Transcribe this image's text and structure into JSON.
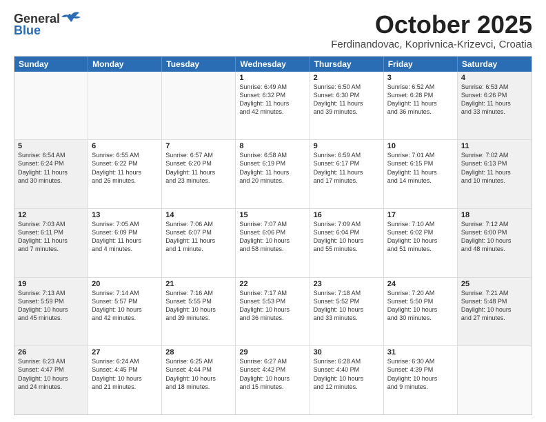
{
  "header": {
    "logo_general": "General",
    "logo_blue": "Blue",
    "month": "October 2025",
    "location": "Ferdinandovac, Koprivnica-Krizevci, Croatia"
  },
  "days_of_week": [
    "Sunday",
    "Monday",
    "Tuesday",
    "Wednesday",
    "Thursday",
    "Friday",
    "Saturday"
  ],
  "weeks": [
    [
      {
        "day": "",
        "text": "",
        "empty": true
      },
      {
        "day": "",
        "text": "",
        "empty": true
      },
      {
        "day": "",
        "text": "",
        "empty": true
      },
      {
        "day": "1",
        "text": "Sunrise: 6:49 AM\nSunset: 6:32 PM\nDaylight: 11 hours\nand 42 minutes.",
        "empty": false
      },
      {
        "day": "2",
        "text": "Sunrise: 6:50 AM\nSunset: 6:30 PM\nDaylight: 11 hours\nand 39 minutes.",
        "empty": false
      },
      {
        "day": "3",
        "text": "Sunrise: 6:52 AM\nSunset: 6:28 PM\nDaylight: 11 hours\nand 36 minutes.",
        "empty": false
      },
      {
        "day": "4",
        "text": "Sunrise: 6:53 AM\nSunset: 6:26 PM\nDaylight: 11 hours\nand 33 minutes.",
        "empty": false,
        "shaded": true
      }
    ],
    [
      {
        "day": "5",
        "text": "Sunrise: 6:54 AM\nSunset: 6:24 PM\nDaylight: 11 hours\nand 30 minutes.",
        "empty": false,
        "shaded": true
      },
      {
        "day": "6",
        "text": "Sunrise: 6:55 AM\nSunset: 6:22 PM\nDaylight: 11 hours\nand 26 minutes.",
        "empty": false
      },
      {
        "day": "7",
        "text": "Sunrise: 6:57 AM\nSunset: 6:20 PM\nDaylight: 11 hours\nand 23 minutes.",
        "empty": false
      },
      {
        "day": "8",
        "text": "Sunrise: 6:58 AM\nSunset: 6:19 PM\nDaylight: 11 hours\nand 20 minutes.",
        "empty": false
      },
      {
        "day": "9",
        "text": "Sunrise: 6:59 AM\nSunset: 6:17 PM\nDaylight: 11 hours\nand 17 minutes.",
        "empty": false
      },
      {
        "day": "10",
        "text": "Sunrise: 7:01 AM\nSunset: 6:15 PM\nDaylight: 11 hours\nand 14 minutes.",
        "empty": false
      },
      {
        "day": "11",
        "text": "Sunrise: 7:02 AM\nSunset: 6:13 PM\nDaylight: 11 hours\nand 10 minutes.",
        "empty": false,
        "shaded": true
      }
    ],
    [
      {
        "day": "12",
        "text": "Sunrise: 7:03 AM\nSunset: 6:11 PM\nDaylight: 11 hours\nand 7 minutes.",
        "empty": false,
        "shaded": true
      },
      {
        "day": "13",
        "text": "Sunrise: 7:05 AM\nSunset: 6:09 PM\nDaylight: 11 hours\nand 4 minutes.",
        "empty": false
      },
      {
        "day": "14",
        "text": "Sunrise: 7:06 AM\nSunset: 6:07 PM\nDaylight: 11 hours\nand 1 minute.",
        "empty": false
      },
      {
        "day": "15",
        "text": "Sunrise: 7:07 AM\nSunset: 6:06 PM\nDaylight: 10 hours\nand 58 minutes.",
        "empty": false
      },
      {
        "day": "16",
        "text": "Sunrise: 7:09 AM\nSunset: 6:04 PM\nDaylight: 10 hours\nand 55 minutes.",
        "empty": false
      },
      {
        "day": "17",
        "text": "Sunrise: 7:10 AM\nSunset: 6:02 PM\nDaylight: 10 hours\nand 51 minutes.",
        "empty": false
      },
      {
        "day": "18",
        "text": "Sunrise: 7:12 AM\nSunset: 6:00 PM\nDaylight: 10 hours\nand 48 minutes.",
        "empty": false,
        "shaded": true
      }
    ],
    [
      {
        "day": "19",
        "text": "Sunrise: 7:13 AM\nSunset: 5:59 PM\nDaylight: 10 hours\nand 45 minutes.",
        "empty": false,
        "shaded": true
      },
      {
        "day": "20",
        "text": "Sunrise: 7:14 AM\nSunset: 5:57 PM\nDaylight: 10 hours\nand 42 minutes.",
        "empty": false
      },
      {
        "day": "21",
        "text": "Sunrise: 7:16 AM\nSunset: 5:55 PM\nDaylight: 10 hours\nand 39 minutes.",
        "empty": false
      },
      {
        "day": "22",
        "text": "Sunrise: 7:17 AM\nSunset: 5:53 PM\nDaylight: 10 hours\nand 36 minutes.",
        "empty": false
      },
      {
        "day": "23",
        "text": "Sunrise: 7:18 AM\nSunset: 5:52 PM\nDaylight: 10 hours\nand 33 minutes.",
        "empty": false
      },
      {
        "day": "24",
        "text": "Sunrise: 7:20 AM\nSunset: 5:50 PM\nDaylight: 10 hours\nand 30 minutes.",
        "empty": false
      },
      {
        "day": "25",
        "text": "Sunrise: 7:21 AM\nSunset: 5:48 PM\nDaylight: 10 hours\nand 27 minutes.",
        "empty": false,
        "shaded": true
      }
    ],
    [
      {
        "day": "26",
        "text": "Sunrise: 6:23 AM\nSunset: 4:47 PM\nDaylight: 10 hours\nand 24 minutes.",
        "empty": false,
        "shaded": true
      },
      {
        "day": "27",
        "text": "Sunrise: 6:24 AM\nSunset: 4:45 PM\nDaylight: 10 hours\nand 21 minutes.",
        "empty": false
      },
      {
        "day": "28",
        "text": "Sunrise: 6:25 AM\nSunset: 4:44 PM\nDaylight: 10 hours\nand 18 minutes.",
        "empty": false
      },
      {
        "day": "29",
        "text": "Sunrise: 6:27 AM\nSunset: 4:42 PM\nDaylight: 10 hours\nand 15 minutes.",
        "empty": false
      },
      {
        "day": "30",
        "text": "Sunrise: 6:28 AM\nSunset: 4:40 PM\nDaylight: 10 hours\nand 12 minutes.",
        "empty": false
      },
      {
        "day": "31",
        "text": "Sunrise: 6:30 AM\nSunset: 4:39 PM\nDaylight: 10 hours\nand 9 minutes.",
        "empty": false
      },
      {
        "day": "",
        "text": "",
        "empty": true,
        "shaded": true
      }
    ]
  ]
}
